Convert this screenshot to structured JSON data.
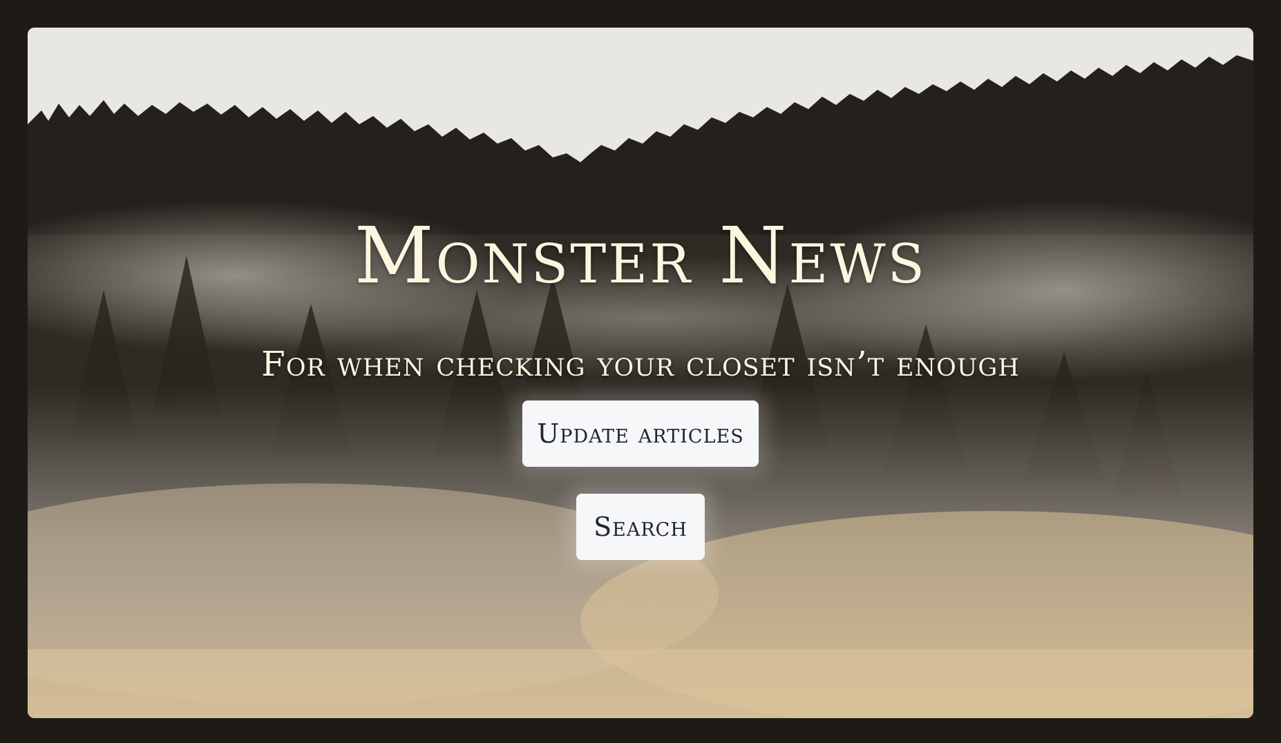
{
  "hero": {
    "title": "Monster News",
    "subtitle": "For when checking your closet isn’t enough"
  },
  "actions": {
    "update_label": "Update articles",
    "search_label": "Search"
  },
  "colors": {
    "text_cream": "#fcf6df",
    "button_bg": "#f6f7f9",
    "button_text": "#1f2430",
    "page_bg": "#1e1b17"
  }
}
